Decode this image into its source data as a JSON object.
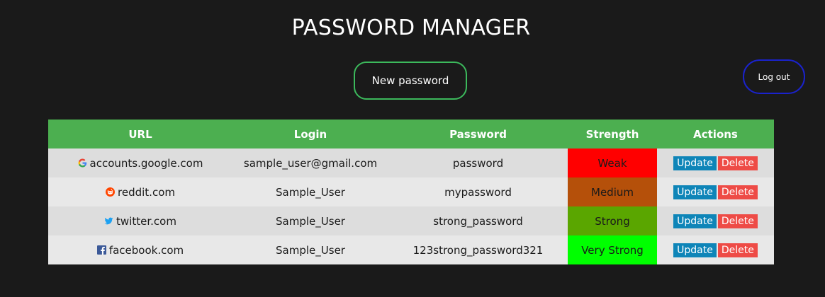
{
  "header": {
    "title": "PASSWORD MANAGER",
    "new_password_label": "New password",
    "logout_label": "Log out"
  },
  "table": {
    "columns": [
      "URL",
      "Login",
      "Password",
      "Strength",
      "Actions"
    ],
    "update_label": "Update",
    "delete_label": "Delete",
    "rows": [
      {
        "icon": "google-icon",
        "url": "accounts.google.com",
        "login": "sample_user@gmail.com",
        "password": "password",
        "strength": "Weak",
        "strength_color": "#ff0000"
      },
      {
        "icon": "reddit-icon",
        "url": "reddit.com",
        "login": "Sample_User",
        "password": "mypassword",
        "strength": "Medium",
        "strength_color": "#b5500a"
      },
      {
        "icon": "twitter-icon",
        "url": "twitter.com",
        "login": "Sample_User",
        "password": "strong_password",
        "strength": "Strong",
        "strength_color": "#5aa600"
      },
      {
        "icon": "facebook-icon",
        "url": "facebook.com",
        "login": "Sample_User",
        "password": "123strong_password321",
        "strength": "Very Strong",
        "strength_color": "#00ff00"
      }
    ]
  },
  "colors": {
    "background": "#1a1a1a",
    "header_green": "#4caf50",
    "new_button_border": "#3cb95c",
    "logout_border": "#1a22cc",
    "update_blue": "#0e85b8",
    "delete_red": "#ee4b46"
  }
}
